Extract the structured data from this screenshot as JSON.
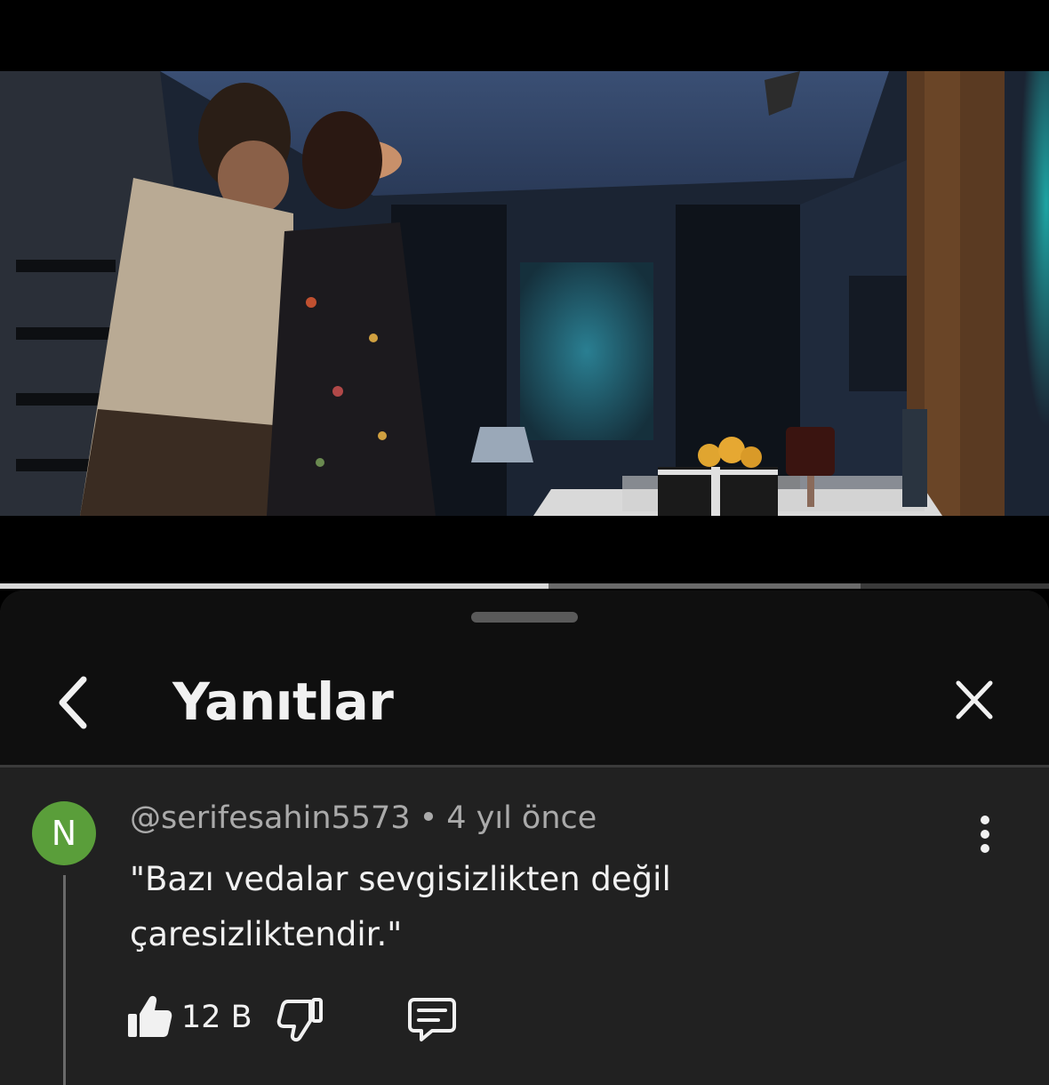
{
  "video": {
    "progress_played": 0.523,
    "progress_buffered": 0.82
  },
  "sheet": {
    "title": "Yanıtlar",
    "icons": {
      "back": "chevron-left-icon",
      "close": "close-icon",
      "more": "more-vertical-icon",
      "like": "thumbs-up-icon",
      "dislike": "thumbs-down-icon",
      "reply": "comment-reply-icon"
    }
  },
  "comment": {
    "avatar_letter": "N",
    "avatar_color": "#5a9e3a",
    "author": "@serifesahin5573",
    "separator": "•",
    "time": "4 yıl önce",
    "text": "\"Bazı vedalar sevgisizlikten değil çaresizliktendir.\"",
    "like_count": "12 B"
  }
}
